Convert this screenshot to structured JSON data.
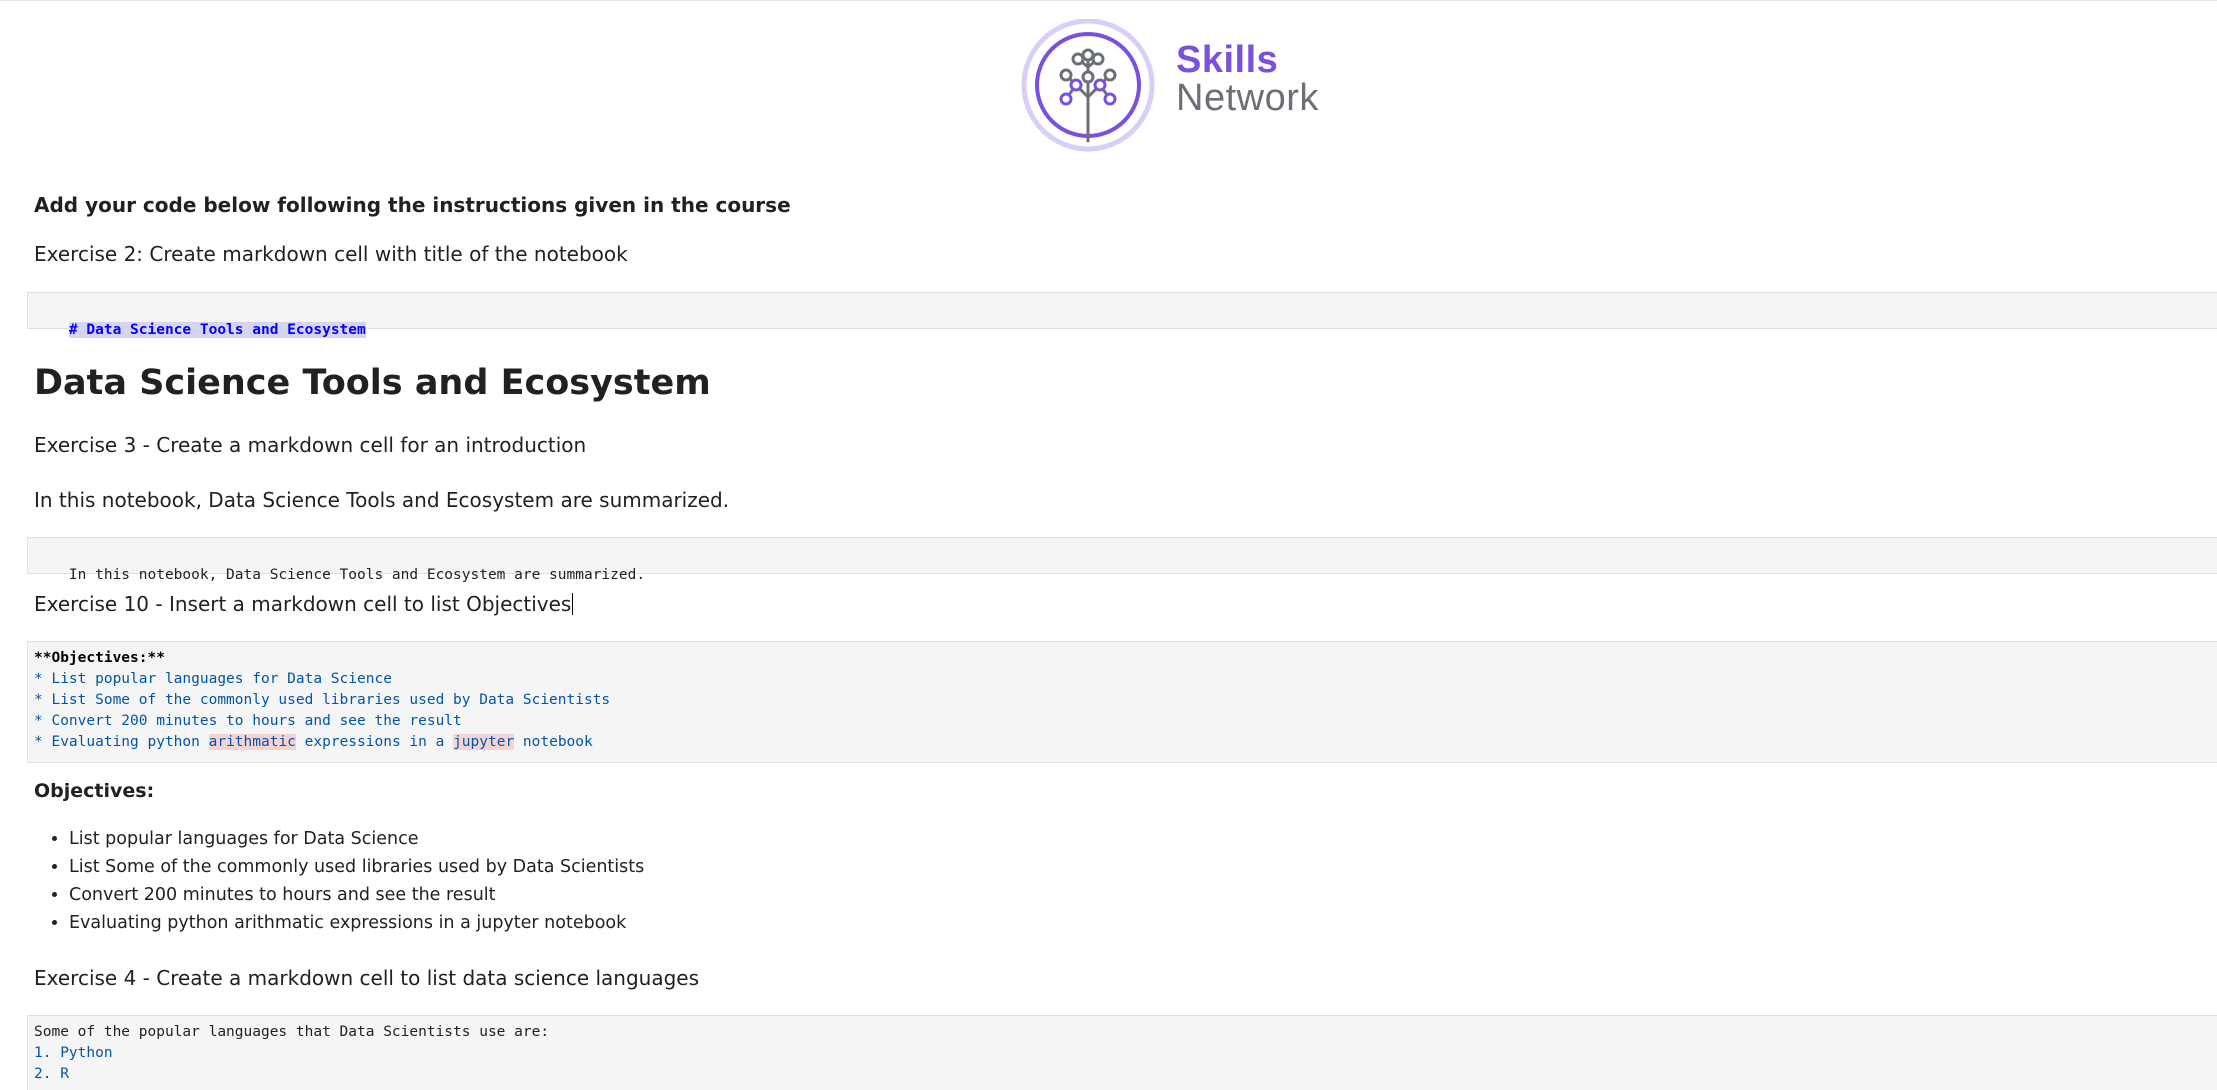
{
  "logo": {
    "line1": "Skills",
    "line2": "Network",
    "brand_color": "#7b4fe0",
    "secondary_color": "#6b7077"
  },
  "cells": {
    "instructions": "Add your code below following the instructions given in the course",
    "exercise2": "Exercise 2: Create markdown cell with title of the notebook",
    "title_source": "# Data Science Tools and Ecosystem",
    "title_rendered": "Data Science Tools and Ecosystem",
    "exercise3": "Exercise 3 - Create a markdown cell for an introduction",
    "intro_rendered": "In this notebook, Data Science Tools and Ecosystem are summarized.",
    "intro_source": "In this notebook, Data Science Tools and Ecosystem are summarized.",
    "exercise10": "Exercise 10 - Insert a markdown cell to list Objectives",
    "objectives_source": {
      "heading": "**Objectives:**",
      "items": [
        "* List popular languages for Data Science",
        "* List Some of the commonly used libraries used by Data Scientists",
        "* Convert 200 minutes to hours and see the result"
      ],
      "last_prefix": "* Evaluating python ",
      "last_word1": "arithmatic",
      "last_middle": " expressions in a ",
      "last_word2": "jupyter",
      "last_suffix": " notebook"
    },
    "objectives_rendered": {
      "heading": "Objectives:",
      "items": [
        "List popular languages for Data Science",
        "List Some of the commonly used libraries used by Data Scientists",
        "Convert 200 minutes to hours and see the result",
        "Evaluating python arithmatic expressions in a jupyter notebook"
      ]
    },
    "exercise4": "Exercise 4 - Create a markdown cell to list data science languages",
    "languages_source": {
      "intro": "Some of the popular languages that Data Scientists use are:",
      "items": [
        "1. Python",
        "2. R"
      ]
    }
  }
}
